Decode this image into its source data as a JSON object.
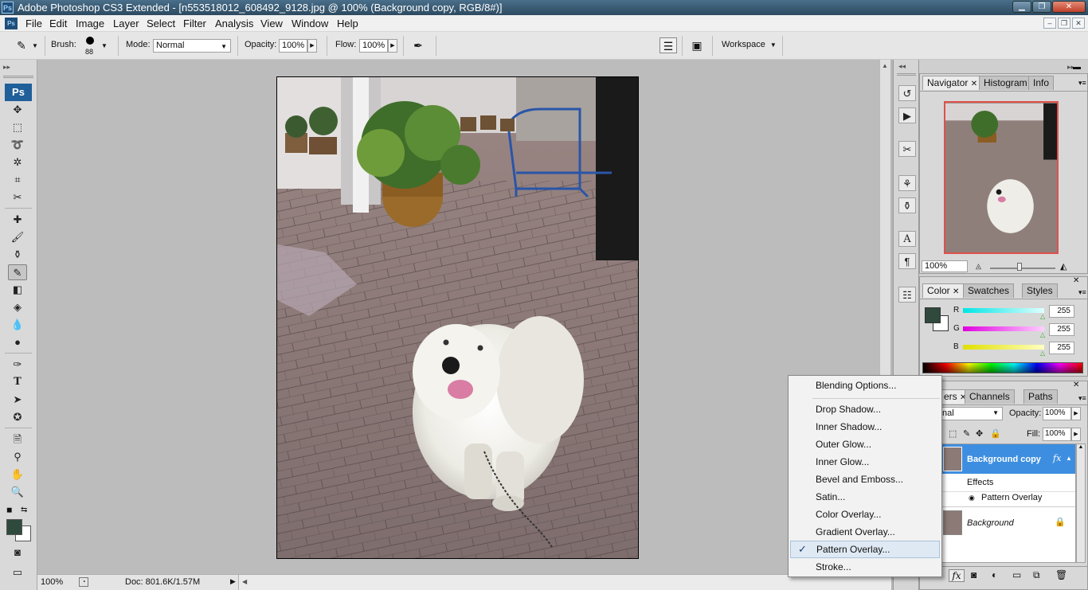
{
  "window": {
    "title": "Adobe Photoshop CS3 Extended - [n553518012_608492_9128.jpg @ 100% (Background copy, RGB/8#)]",
    "app_badge": "Ps"
  },
  "menu": [
    "File",
    "Edit",
    "Image",
    "Layer",
    "Select",
    "Filter",
    "Analysis",
    "View",
    "Window",
    "Help"
  ],
  "options_bar": {
    "brush_label": "Brush:",
    "brush_size": "88",
    "mode_label": "Mode:",
    "mode_value": "Normal",
    "opacity_label": "Opacity:",
    "opacity_value": "100%",
    "flow_label": "Flow:",
    "flow_value": "100%",
    "workspace_label": "Workspace"
  },
  "tools": {
    "badge": "Ps",
    "foreground_color": "#2f4a3c",
    "background_color": "#ffffff"
  },
  "status": {
    "zoom": "100%",
    "doc": "Doc: 801.6K/1.57M"
  },
  "navigator": {
    "tabs": [
      "Navigator",
      "Histogram",
      "Info"
    ],
    "zoom": "100%"
  },
  "color_panel": {
    "tabs": [
      "Color",
      "Swatches",
      "Styles"
    ],
    "channels": [
      {
        "label": "R",
        "value": "255",
        "color": "#00d0d0"
      },
      {
        "label": "G",
        "value": "255",
        "color": "#e000e0"
      },
      {
        "label": "B",
        "value": "255",
        "color": "#e0e000"
      }
    ],
    "foreground": "#2f4a3c"
  },
  "layers_panel": {
    "tabs": [
      "ers",
      "Channels",
      "Paths"
    ],
    "blend_mode": "nal",
    "opacity_label": "Opacity:",
    "opacity_value": "100%",
    "fill_label": "Fill:",
    "fill_value": "100%",
    "layers": [
      {
        "name": "Background copy",
        "selected": true
      },
      {
        "name": "Background",
        "selected": false
      }
    ],
    "effects_label": "Effects",
    "effect_item": "Pattern Overlay",
    "fx": "fx"
  },
  "context_menu": {
    "items": [
      "Blending Options...",
      "Drop Shadow...",
      "Inner Shadow...",
      "Outer Glow...",
      "Inner Glow...",
      "Bevel and Emboss...",
      "Satin...",
      "Color Overlay...",
      "Gradient Overlay...",
      "Pattern Overlay...",
      "Stroke..."
    ],
    "checked_index": 9
  }
}
